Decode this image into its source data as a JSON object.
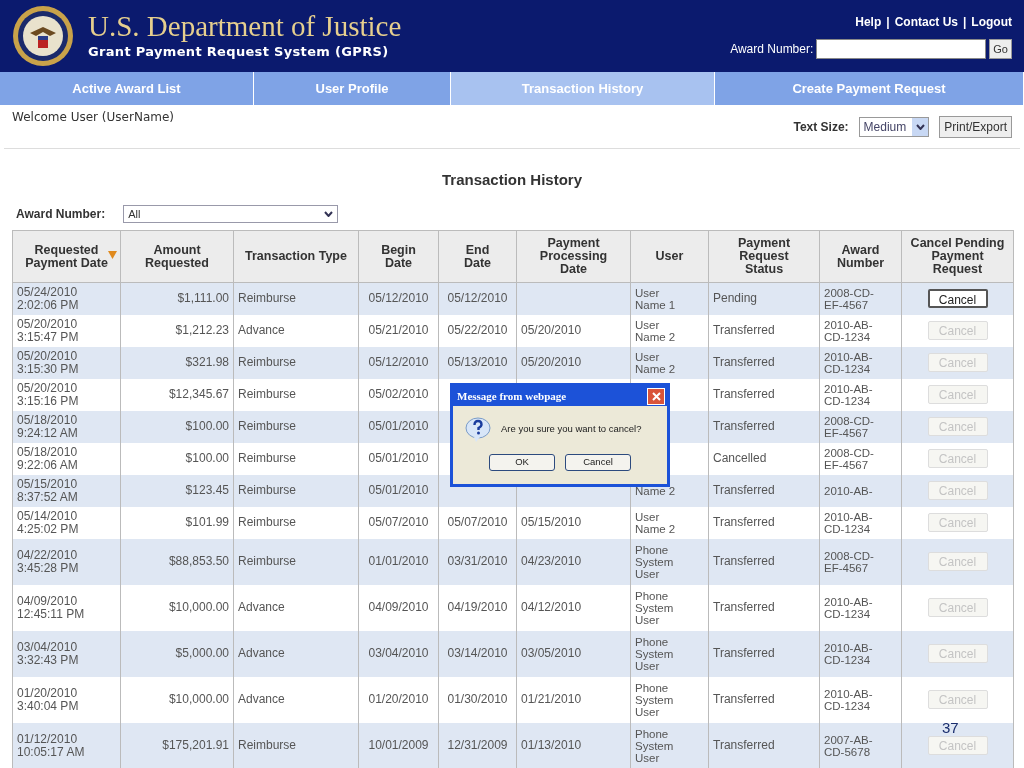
{
  "header": {
    "title": "U.S. Department of Justice",
    "subtitle": "Grant Payment Request System (GPRS)",
    "links": [
      "Help",
      "Contact Us",
      "Logout"
    ],
    "link_separator": "|",
    "award_label": "Award Number:",
    "go_button": "Go"
  },
  "nav": [
    {
      "label": "Active Award List",
      "selected": false
    },
    {
      "label": "User Profile",
      "selected": false
    },
    {
      "label": "Transaction History",
      "selected": true
    },
    {
      "label": "Create Payment Request",
      "selected": false
    }
  ],
  "welcome": "Welcome User (UserName)",
  "text_size": {
    "label": "Text Size:",
    "value": "Medium"
  },
  "print_button": "Print/Export",
  "page_title": "Transaction History",
  "filter": {
    "label": "Award Number:",
    "value": "All"
  },
  "table": {
    "columns": [
      {
        "label": "Requested\nPayment Date",
        "sorted": true
      },
      {
        "label": "Amount\nRequested",
        "sorted": false
      },
      {
        "label": "Transaction Type",
        "sorted": false
      },
      {
        "label": "Begin\nDate",
        "sorted": false
      },
      {
        "label": "End\nDate",
        "sorted": false
      },
      {
        "label": "Payment\nProcessing\nDate",
        "sorted": false
      },
      {
        "label": "User",
        "sorted": false
      },
      {
        "label": "Payment\nRequest\nStatus",
        "sorted": false
      },
      {
        "label": "Award\nNumber",
        "sorted": false
      },
      {
        "label": "Cancel Pending\nPayment\nRequest",
        "sorted": false
      }
    ],
    "rows": [
      {
        "date": "05/24/2010\n2:02:06 PM",
        "amount": "$1,111.00",
        "type": "Reimburse",
        "begin": "05/12/2010",
        "end": "05/12/2010",
        "user": "User\nName 1",
        "status": "Pending",
        "award": "2008-CD-\nEF-4567",
        "cancel": {
          "label": "Cancel",
          "disabled": false
        }
      },
      {
        "date": "05/20/2010\n3:15:47 PM",
        "amount": "$1,212.23",
        "type": "Advance",
        "begin": "05/21/2010",
        "end": "05/22/2010",
        "processing": "05/20/2010",
        "user": "User\nName 2",
        "status": "Transferred",
        "award": "2010-AB-\nCD-1234",
        "cancel": {
          "label": "Cancel",
          "disabled": true
        }
      },
      {
        "date": "05/20/2010\n3:15:30 PM",
        "amount": "$321.98",
        "type": "Reimburse",
        "begin": "05/12/2010",
        "end": "05/13/2010",
        "processing": "05/20/2010",
        "user": "User\nName 2",
        "status": "Transferred",
        "award": "2010-AB-\nCD-1234",
        "cancel": {
          "label": "Cancel",
          "disabled": true
        }
      },
      {
        "date": "05/20/2010\n3:15:16 PM",
        "amount": "$12,345.67",
        "type": "Reimburse",
        "begin": "05/02/2010",
        "status": "Transferred",
        "award": "2010-AB-\nCD-1234",
        "cancel": {
          "label": "Cancel",
          "disabled": true
        }
      },
      {
        "date": "05/18/2010\n9:24:12 AM",
        "amount": "$100.00",
        "type": "Reimburse",
        "begin": "05/01/2010",
        "status": "Transferred",
        "award": "2008-CD-\nEF-4567",
        "cancel": {
          "label": "Cancel",
          "disabled": true
        }
      },
      {
        "date": "05/18/2010\n9:22:06 AM",
        "amount": "$100.00",
        "type": "Reimburse",
        "begin": "05/01/2010",
        "status": "Cancelled",
        "award": "2008-CD-\nEF-4567",
        "cancel": {
          "label": "Cancel",
          "disabled": true
        }
      },
      {
        "date": "05/15/2010\n8:37:52 AM",
        "amount": "$123.45",
        "type": "Reimburse",
        "begin": "05/01/2010",
        "user": "Name 2",
        "status": "Transferred",
        "award": "2010-AB-",
        "cancel": {
          "label": "Cancel",
          "disabled": true
        }
      },
      {
        "date": "05/14/2010\n4:25:02 PM",
        "amount": "$101.99",
        "type": "Reimburse",
        "begin": "05/07/2010",
        "end": "05/07/2010",
        "processing": "05/15/2010",
        "user": "User\nName 2",
        "status": "Transferred",
        "award": "2010-AB-\nCD-1234",
        "cancel": {
          "label": "Cancel",
          "disabled": true
        }
      },
      {
        "date": "04/22/2010\n3:45:28 PM",
        "amount": "$88,853.50",
        "type": "Reimburse",
        "begin": "01/01/2010",
        "end": "03/31/2010",
        "processing": "04/23/2010",
        "user": "Phone\nSystem\nUser",
        "status": "Transferred",
        "award": "2008-CD-\nEF-4567",
        "cancel": {
          "label": "Cancel",
          "disabled": true
        }
      },
      {
        "date": "04/09/2010\n12:45:11 PM",
        "amount": "$10,000.00",
        "type": "Advance",
        "begin": "04/09/2010",
        "end": "04/19/2010",
        "processing": "04/12/2010",
        "user": "Phone\nSystem\nUser",
        "status": "Transferred",
        "award": "2010-AB-\nCD-1234",
        "cancel": {
          "label": "Cancel",
          "disabled": true
        }
      },
      {
        "date": "03/04/2010\n3:32:43 PM",
        "amount": "$5,000.00",
        "type": "Advance",
        "begin": "03/04/2010",
        "end": "03/14/2010",
        "processing": "03/05/2010",
        "user": "Phone\nSystem\nUser",
        "status": "Transferred",
        "award": "2010-AB-\nCD-1234",
        "cancel": {
          "label": "Cancel",
          "disabled": true
        }
      },
      {
        "date": "01/20/2010\n3:40:04 PM",
        "amount": "$10,000.00",
        "type": "Advance",
        "begin": "01/20/2010",
        "end": "01/30/2010",
        "processing": "01/21/2010",
        "user": "Phone\nSystem\nUser",
        "status": "Transferred",
        "award": "2010-AB-\nCD-1234",
        "cancel": {
          "label": "Cancel",
          "disabled": true
        }
      },
      {
        "date": "01/12/2010\n10:05:17 AM",
        "amount": "$175,201.91",
        "type": "Reimburse",
        "begin": "10/01/2009",
        "end": "12/31/2009",
        "processing": "01/13/2010",
        "user": "Phone\nSystem\nUser",
        "status": "Transferred",
        "award": "2007-AB-\nCD-5678",
        "cancel": {
          "label": "Cancel",
          "disabled": true
        }
      }
    ]
  },
  "dialog": {
    "title": "Message from webpage",
    "message": "Are you sure you want to cancel?",
    "buttons": [
      "OK",
      "Cancel"
    ]
  },
  "page_number": "37"
}
